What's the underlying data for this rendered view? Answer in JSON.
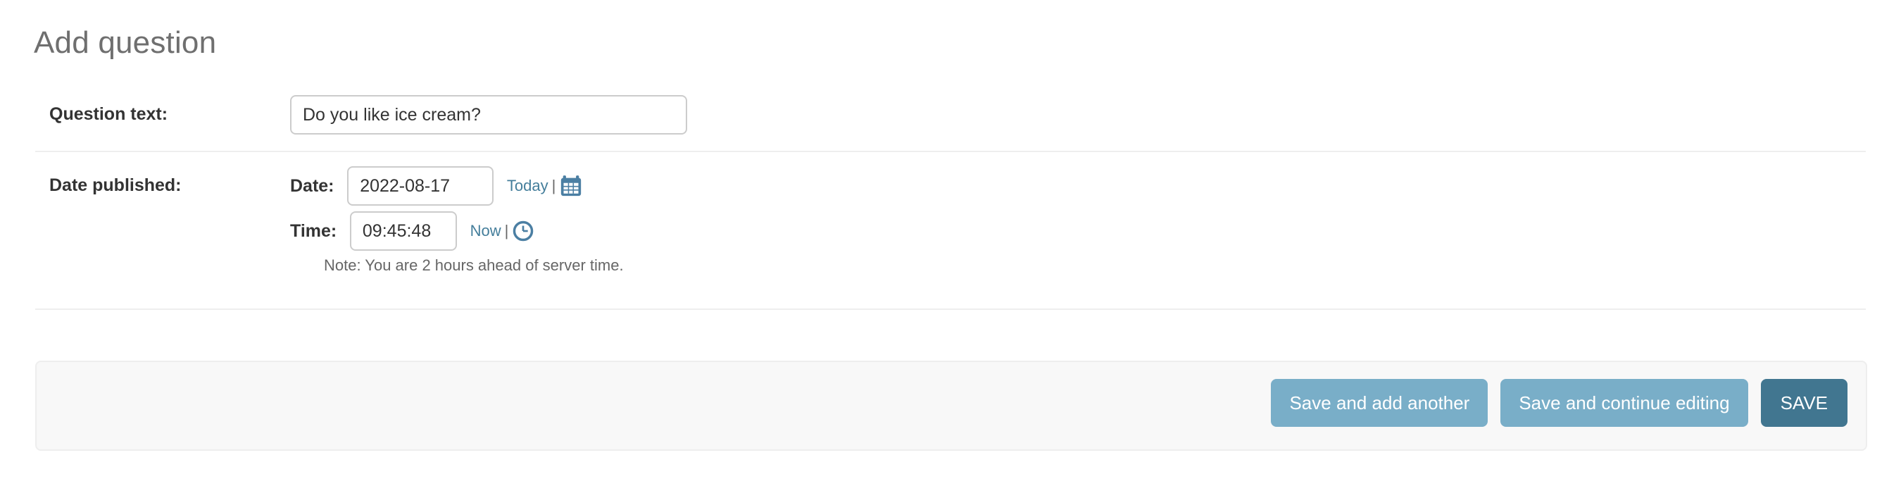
{
  "page": {
    "title": "Add question"
  },
  "form": {
    "rows": [
      {
        "label": "Question text:",
        "value": "Do you like ice cream?"
      },
      {
        "label": "Date published:"
      }
    ],
    "question_text": {
      "label": "Question text:",
      "value": "Do you like ice cream?",
      "placeholder": ""
    },
    "date_published": {
      "label": "Date published:",
      "date": {
        "label": "Date:",
        "value": "2022-08-17",
        "shortcut_label": "Today",
        "separator": "|",
        "icon": "calendar-icon"
      },
      "time": {
        "label": "Time:",
        "value": "09:45:48",
        "shortcut_label": "Now",
        "separator": "|",
        "icon": "clock-icon"
      },
      "note": "Note: You are 2 hours ahead of server time."
    }
  },
  "submit_row": {
    "save_and_add_another": "Save and add another",
    "save_and_continue_editing": "Save and continue editing",
    "save": "SAVE"
  },
  "colors": {
    "primary": "#79aec8",
    "primary_dark": "#417690",
    "link": "#447e9b",
    "title_text": "#6f6f6f",
    "body_text": "#333333",
    "muted_text": "#666666",
    "border": "#cccccc",
    "divider": "#eeeeee",
    "submit_row_bg": "#f8f8f8",
    "page_bg": "#ffffff"
  }
}
